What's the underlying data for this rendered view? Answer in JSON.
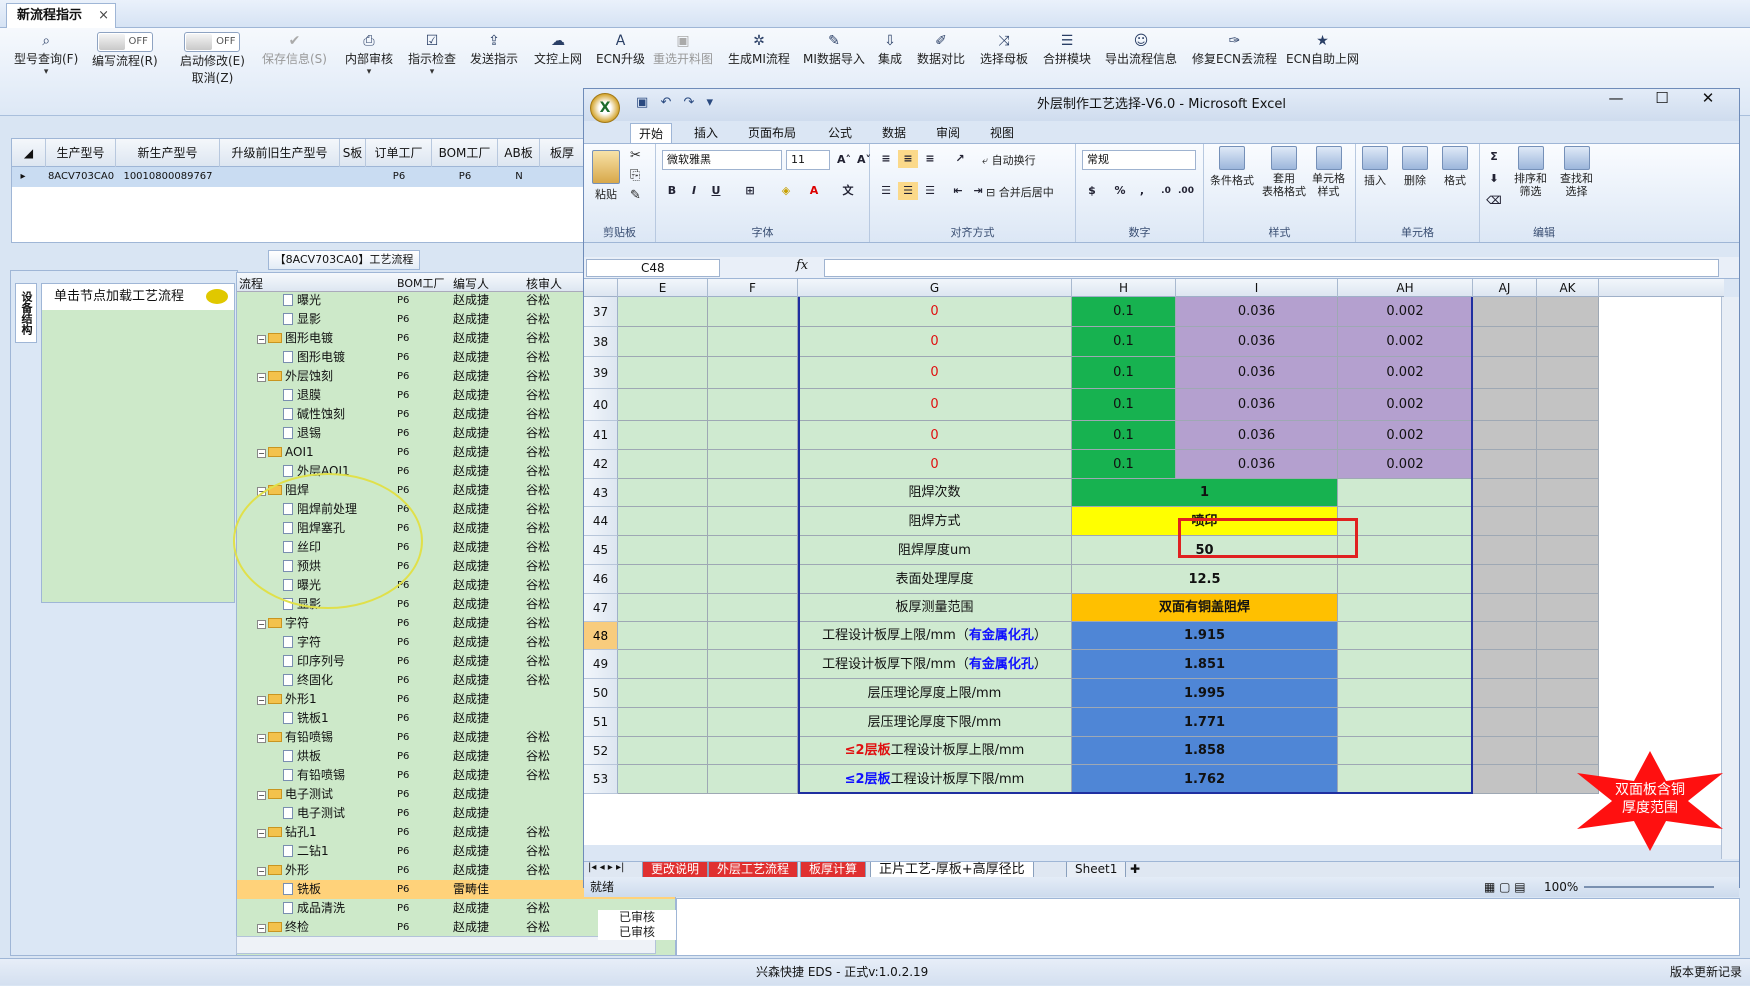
{
  "app": {
    "main_tab": "新流程指示",
    "close_glyph": "×",
    "status_center": "兴森快捷 EDS - 正式v:1.0.2.19",
    "status_right": "版本更新记录"
  },
  "toolbar": {
    "items": [
      {
        "label": "型号查询(F)",
        "icon": "search-icon",
        "glyph": "⌕"
      },
      {
        "label": "编写流程(R)",
        "toggle": "OFF"
      },
      {
        "label": "启动修改(E)",
        "label2": "取消(Z)",
        "toggle": "OFF"
      },
      {
        "label": "保存信息(S)",
        "glyph": "✔",
        "disabled": true
      },
      {
        "label": "内部审核",
        "glyph": "⎙"
      },
      {
        "label": "指示检查",
        "glyph": "☑"
      },
      {
        "label": "发送指示",
        "glyph": "⇪"
      },
      {
        "label": "文控上网",
        "glyph": "☁"
      },
      {
        "label": "ECN升级",
        "glyph": "A"
      },
      {
        "label": "重选开料图",
        "glyph": "▣",
        "disabled": true
      },
      {
        "label": "生成MI流程",
        "glyph": "✲"
      },
      {
        "label": "MI数据导入",
        "glyph": "✎"
      },
      {
        "label": "集成",
        "glyph": "⇩"
      },
      {
        "label": "数据对比",
        "glyph": "✐"
      },
      {
        "label": "选择母板",
        "glyph": "⤨"
      },
      {
        "label": "合拼模块",
        "glyph": "☰"
      },
      {
        "label": "导出流程信息",
        "glyph": "☺"
      },
      {
        "label": "修复ECN丢流程",
        "glyph": "✑"
      },
      {
        "label": "ECN自助上网",
        "glyph": "★"
      }
    ]
  },
  "grid": {
    "columns": [
      "生产型号",
      "新生产型号",
      "升级前旧生产型号",
      "S板",
      "订单工厂",
      "BOM工厂",
      "AB板",
      "板厚"
    ],
    "row": [
      "8ACV703CA0",
      "10010800089767",
      "",
      "",
      "P6",
      "P6",
      "N",
      ""
    ]
  },
  "tree": {
    "title": "【8ACV703CA0】工艺流程",
    "side_tab": "设备结构",
    "node_hint": "单击节点加载工艺流程",
    "headers": [
      "流程",
      "BOM工厂",
      "编写人",
      "核审人"
    ],
    "rows": [
      {
        "name": "曝光",
        "type": "doc",
        "bom": "P6",
        "writer": "赵成捷",
        "reviewer": "谷松"
      },
      {
        "name": "显影",
        "type": "doc",
        "bom": "P6",
        "writer": "赵成捷",
        "reviewer": "谷松"
      },
      {
        "name": "图形电镀",
        "type": "folder",
        "bom": "P6",
        "writer": "赵成捷",
        "reviewer": "谷松"
      },
      {
        "name": "图形电镀",
        "type": "doc",
        "bom": "P6",
        "writer": "赵成捷",
        "reviewer": "谷松"
      },
      {
        "name": "外层蚀刻",
        "type": "folder",
        "bom": "P6",
        "writer": "赵成捷",
        "reviewer": "谷松"
      },
      {
        "name": "退膜",
        "type": "doc",
        "bom": "P6",
        "writer": "赵成捷",
        "reviewer": "谷松"
      },
      {
        "name": "碱性蚀刻",
        "type": "doc",
        "bom": "P6",
        "writer": "赵成捷",
        "reviewer": "谷松"
      },
      {
        "name": "退锡",
        "type": "doc",
        "bom": "P6",
        "writer": "赵成捷",
        "reviewer": "谷松"
      },
      {
        "name": "AOI1",
        "type": "folder",
        "bom": "P6",
        "writer": "赵成捷",
        "reviewer": "谷松"
      },
      {
        "name": "外层AOI1",
        "type": "doc",
        "bom": "P6",
        "writer": "赵成捷",
        "reviewer": "谷松"
      },
      {
        "name": "阻焊",
        "type": "folder",
        "bom": "P6",
        "writer": "赵成捷",
        "reviewer": "谷松"
      },
      {
        "name": "阻焊前处理",
        "type": "doc",
        "bom": "P6",
        "writer": "赵成捷",
        "reviewer": "谷松"
      },
      {
        "name": "阻焊塞孔",
        "type": "doc",
        "bom": "P6",
        "writer": "赵成捷",
        "reviewer": "谷松"
      },
      {
        "name": "丝印",
        "type": "doc",
        "bom": "P6",
        "writer": "赵成捷",
        "reviewer": "谷松"
      },
      {
        "name": "预烘",
        "type": "doc",
        "bom": "P6",
        "writer": "赵成捷",
        "reviewer": "谷松"
      },
      {
        "name": "曝光",
        "type": "doc",
        "bom": "P6",
        "writer": "赵成捷",
        "reviewer": "谷松"
      },
      {
        "name": "显影",
        "type": "doc",
        "bom": "P6",
        "writer": "赵成捷",
        "reviewer": "谷松"
      },
      {
        "name": "字符",
        "type": "folder",
        "bom": "P6",
        "writer": "赵成捷",
        "reviewer": "谷松"
      },
      {
        "name": "字符",
        "type": "doc",
        "bom": "P6",
        "writer": "赵成捷",
        "reviewer": "谷松"
      },
      {
        "name": "印序列号",
        "type": "doc",
        "bom": "P6",
        "writer": "赵成捷",
        "reviewer": "谷松"
      },
      {
        "name": "终固化",
        "type": "doc",
        "bom": "P6",
        "writer": "赵成捷",
        "reviewer": "谷松"
      },
      {
        "name": "外形1",
        "type": "folder",
        "bom": "P6",
        "writer": "赵成捷",
        "reviewer": ""
      },
      {
        "name": "铣板1",
        "type": "doc",
        "bom": "P6",
        "writer": "赵成捷",
        "reviewer": ""
      },
      {
        "name": "有铅喷锡",
        "type": "folder",
        "bom": "P6",
        "writer": "赵成捷",
        "reviewer": "谷松"
      },
      {
        "name": "烘板",
        "type": "doc",
        "bom": "P6",
        "writer": "赵成捷",
        "reviewer": "谷松"
      },
      {
        "name": "有铅喷锡",
        "type": "doc",
        "bom": "P6",
        "writer": "赵成捷",
        "reviewer": "谷松"
      },
      {
        "name": "电子测试",
        "type": "folder",
        "bom": "P6",
        "writer": "赵成捷",
        "reviewer": ""
      },
      {
        "name": "电子测试",
        "type": "doc",
        "bom": "P6",
        "writer": "赵成捷",
        "reviewer": ""
      },
      {
        "name": "钻孔1",
        "type": "folder",
        "bom": "P6",
        "writer": "赵成捷",
        "reviewer": "谷松"
      },
      {
        "name": "二钻1",
        "type": "doc",
        "bom": "P6",
        "writer": "赵成捷",
        "reviewer": "谷松"
      },
      {
        "name": "外形",
        "type": "folder",
        "bom": "P6",
        "writer": "赵成捷",
        "reviewer": "谷松"
      },
      {
        "name": "铣板",
        "type": "doc",
        "bom": "P6",
        "writer": "雷畴佳",
        "reviewer": "",
        "selected": true
      },
      {
        "name": "成品清洗",
        "type": "doc",
        "bom": "P6",
        "writer": "赵成捷",
        "reviewer": "谷松"
      },
      {
        "name": "终检",
        "type": "folder",
        "bom": "P6",
        "writer": "赵成捷",
        "reviewer": "谷松"
      }
    ],
    "review_status": [
      "已审核",
      "已审核"
    ]
  },
  "excel": {
    "title": "外层制作工艺选择-V6.0 - Microsoft Excel",
    "logo": "X",
    "ribbon_tabs": [
      "开始",
      "插入",
      "页面布局",
      "公式",
      "数据",
      "审阅",
      "视图"
    ],
    "font_name": "微软雅黑",
    "font_size": "11",
    "number_format": "常规",
    "groups": [
      "剪贴板",
      "字体",
      "对齐方式",
      "数字",
      "样式",
      "单元格",
      "编辑"
    ],
    "buttons": {
      "paste": "粘贴",
      "wrap": "自动换行",
      "merge": "合并后居中",
      "cond_format": "条件格式",
      "table_format": "套用\n表格格式",
      "cell_style": "单元格\n样式",
      "insert": "插入",
      "delete": "删除",
      "format": "格式",
      "sort": "排序和\n筛选",
      "find": "查找和\n选择",
      "bold": "B",
      "italic": "I",
      "underline": "U",
      "font_grow": "A˄",
      "font_shrink": "A˅",
      "percent": "%",
      "comma": ",",
      "sum_icon": "Σ"
    },
    "name_box": "C48",
    "fx": "fx",
    "col_headers": [
      "E",
      "F",
      "G",
      "H",
      "I",
      "AH",
      "AJ",
      "AK"
    ],
    "rows": [
      {
        "n": "37",
        "g": "0",
        "h": "0.1",
        "i": "0.036",
        "ah": "0.002"
      },
      {
        "n": "38",
        "g": "0",
        "h": "0.1",
        "i": "0.036",
        "ah": "0.002"
      },
      {
        "n": "39",
        "g": "0",
        "h": "0.1",
        "i": "0.036",
        "ah": "0.002"
      },
      {
        "n": "40",
        "g": "0",
        "h": "0.1",
        "i": "0.036",
        "ah": "0.002"
      },
      {
        "n": "41",
        "g": "0",
        "h": "0.1",
        "i": "0.036",
        "ah": "0.002"
      },
      {
        "n": "42",
        "g": "0",
        "h": "0.1",
        "i": "0.036",
        "ah": "0.002"
      }
    ],
    "param_rows": [
      {
        "n": "43",
        "label": "阻焊次数",
        "value": "1",
        "style": "dkgr"
      },
      {
        "n": "44",
        "label": "阻焊方式",
        "value": "喷印",
        "style": "yel"
      },
      {
        "n": "45",
        "label": "阻焊厚度um",
        "value": "50",
        "style": "gr"
      },
      {
        "n": "46",
        "label": "表面处理厚度",
        "value": "12.5",
        "style": "gr"
      },
      {
        "n": "47",
        "label": "板厚测量范围",
        "value": "双面有铜盖阻焊",
        "style": "org"
      },
      {
        "n": "48",
        "label_a": "工程设计板厚上限/mm（",
        "label_b": "有金属化孔",
        "label_c": "）",
        "value": "1.915",
        "style": "blu"
      },
      {
        "n": "49",
        "label_a": "工程设计板厚下限/mm（",
        "label_b": "有金属化孔",
        "label_c": "）",
        "value": "1.851",
        "style": "blu"
      },
      {
        "n": "50",
        "label": "层压理论厚度上限/mm",
        "value": "1.995",
        "style": "blu"
      },
      {
        "n": "51",
        "label": "层压理论厚度下限/mm",
        "value": "1.771",
        "style": "blu"
      },
      {
        "n": "52",
        "label_red": "≤2层板",
        "label_rest": "工程设计板厚上限/mm",
        "value": "1.858",
        "style": "blu"
      },
      {
        "n": "53",
        "label_blue": "≤2层板",
        "label_rest": "工程设计板厚下限/mm",
        "value": "1.762",
        "style": "blu"
      }
    ],
    "star_text": "双面板含铜\n厚度范围",
    "sheet_tabs": [
      "更改说明",
      "外层工艺流程",
      "板厚计算",
      "正片工艺-厚板+高厚径比",
      "Sheet1"
    ],
    "status_ready": "就绪",
    "zoom": "100%"
  }
}
